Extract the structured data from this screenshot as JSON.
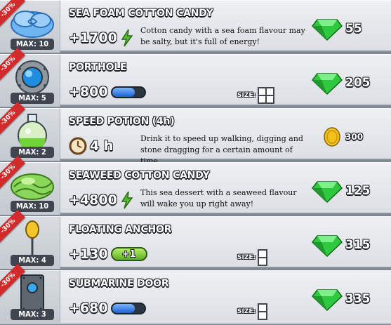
{
  "colors": {
    "ribbon": "#d32b2b",
    "gem": "#2fc93f",
    "energy": "#55b92e",
    "bar_fill": "#2f76e6",
    "coin": "#f2c21b"
  },
  "items": [
    {
      "discount": "-30%",
      "max": "MAX: 10",
      "name": "SEA FOAM COTTON CANDY",
      "stat": "+1700",
      "stat_icon": "lightning-icon",
      "description": "Cotton candy with a sea foam flavour may be salty, but it's full of energy!",
      "price": "55",
      "currency_icon": "gem-icon"
    },
    {
      "discount": "-30%",
      "max": "MAX: 5",
      "name": "PORTHOLE",
      "stat": "+800",
      "stat_icon": "comfort-bar-icon",
      "bar_level": 0.7,
      "size_label": "SIZE:",
      "size_icon": "grid-2x2-icon",
      "price": "205",
      "currency_icon": "gem-icon"
    },
    {
      "discount": "-30%",
      "max": "MAX: 2",
      "name": "SPEED POTION (4h)",
      "stat": "4 h",
      "stat_icon": "clock-icon",
      "description": "Drink it to speed up walking, digging and stone dragging for a certain amount of time.",
      "price": "300",
      "currency_icon": "coin-icon"
    },
    {
      "discount": "-30%",
      "max": "MAX: 10",
      "name": "SEAWEED COTTON CANDY",
      "stat": "+4800",
      "stat_icon": "lightning-icon",
      "description": "This sea dessert with a seaweed flavour will wake you up right away!",
      "price": "125",
      "currency_icon": "gem-icon"
    },
    {
      "discount": "-30%",
      "max": "MAX: 4",
      "name": "FLOATING ANCHOR",
      "stat": "+130",
      "stat_icon": "energy-pill-icon",
      "pill_text": "+1",
      "size_label": "SIZE:",
      "size_icon": "grid-1x2-icon",
      "price": "315",
      "currency_icon": "gem-icon"
    },
    {
      "discount": "-30%",
      "max": "MAX: 3",
      "name": "SUBMARINE DOOR",
      "stat": "+680",
      "stat_icon": "comfort-bar-icon",
      "bar_level": 0.7,
      "size_label": "SIZE:",
      "size_icon": "grid-1x2-icon",
      "price": "335",
      "currency_icon": "gem-icon"
    }
  ]
}
